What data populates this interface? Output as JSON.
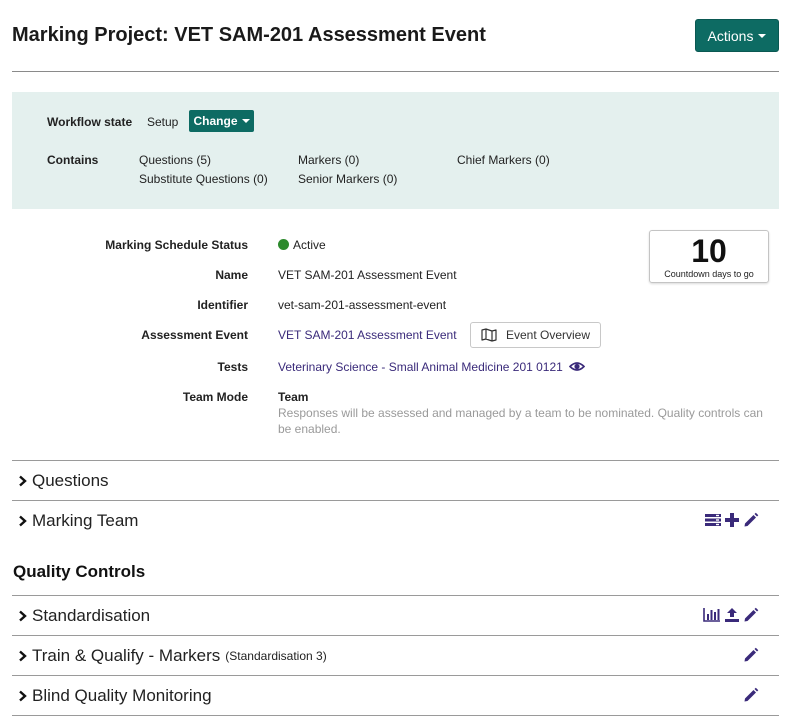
{
  "header": {
    "title": "Marking Project: VET SAM-201 Assessment Event",
    "actions_label": "Actions"
  },
  "summary": {
    "workflow_label": "Workflow state",
    "workflow_value": "Setup",
    "change_label": "Change",
    "contains_label": "Contains",
    "contains": {
      "questions": "Questions (5)",
      "substitute_questions": "Substitute Questions (0)",
      "markers": "Markers (0)",
      "senior_markers": "Senior Markers (0)",
      "chief_markers": "Chief Markers (0)"
    }
  },
  "details": {
    "status_label": "Marking Schedule Status",
    "status_value": "Active",
    "status_color": "#2d8a2d",
    "name_label": "Name",
    "name_value": "VET SAM-201 Assessment Event",
    "identifier_label": "Identifier",
    "identifier_value": "vet-sam-201-assessment-event",
    "event_label": "Assessment Event",
    "event_value": "VET SAM-201 Assessment Event",
    "event_overview_label": "Event Overview",
    "tests_label": "Tests",
    "tests_value": "Veterinary Science - Small Animal Medicine 201 0121",
    "team_mode_label": "Team Mode",
    "team_mode_value": "Team",
    "team_mode_description": "Responses will be assessed and managed by a team to be nominated. Quality controls can be enabled."
  },
  "countdown": {
    "value": "10",
    "caption": "Countdown days to go"
  },
  "sections": {
    "questions": "Questions",
    "marking_team": "Marking Team",
    "quality_controls_heading": "Quality Controls",
    "standardisation": "Standardisation",
    "train_qualify": "Train & Qualify - Markers",
    "train_qualify_sub": "(Standardisation 3)",
    "blind_monitoring": "Blind Quality Monitoring"
  },
  "icons": {
    "primary_color": "#3a2a7a",
    "accent_color": "#0d6b63"
  }
}
